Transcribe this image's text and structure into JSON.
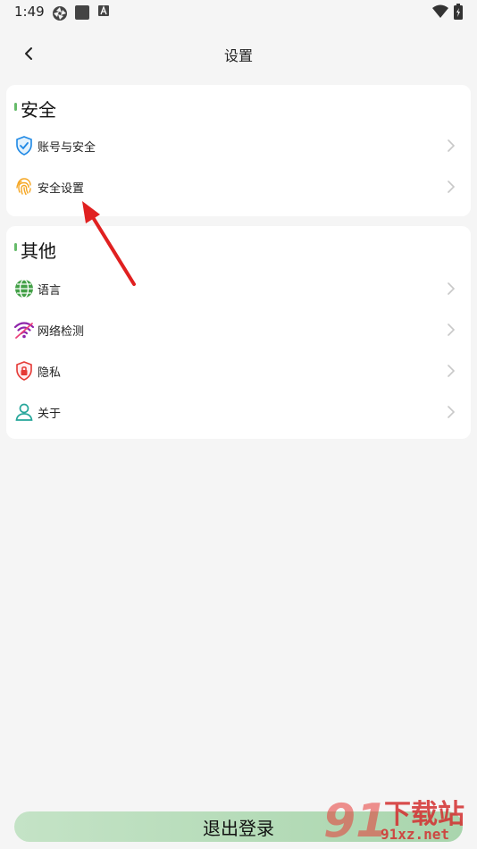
{
  "status_bar": {
    "time": "1:49",
    "icons": [
      "photos-icon",
      "square-app-icon",
      "a-badge-icon",
      "wifi-icon",
      "battery-icon"
    ]
  },
  "header": {
    "title": "设置",
    "back_icon": "chevron-left-icon"
  },
  "sections": [
    {
      "title": "安全",
      "items": [
        {
          "label": "账号与安全",
          "icon": "shield-check-icon"
        },
        {
          "label": "安全设置",
          "icon": "fingerprint-icon"
        }
      ]
    },
    {
      "title": "其他",
      "items": [
        {
          "label": "语言",
          "icon": "globe-icon"
        },
        {
          "label": "网络检测",
          "icon": "wifi-signal-icon"
        },
        {
          "label": "隐私",
          "icon": "lock-shield-icon"
        },
        {
          "label": "关于",
          "icon": "person-icon"
        }
      ]
    }
  ],
  "logout": {
    "label": "退出登录"
  },
  "watermark": {
    "text_top": "下载站",
    "text_bottom": "91xz.net"
  },
  "colors": {
    "accent_green": "#66bb6a",
    "logout_bg": "#b5dcb8",
    "annotation_red": "#e02020"
  }
}
